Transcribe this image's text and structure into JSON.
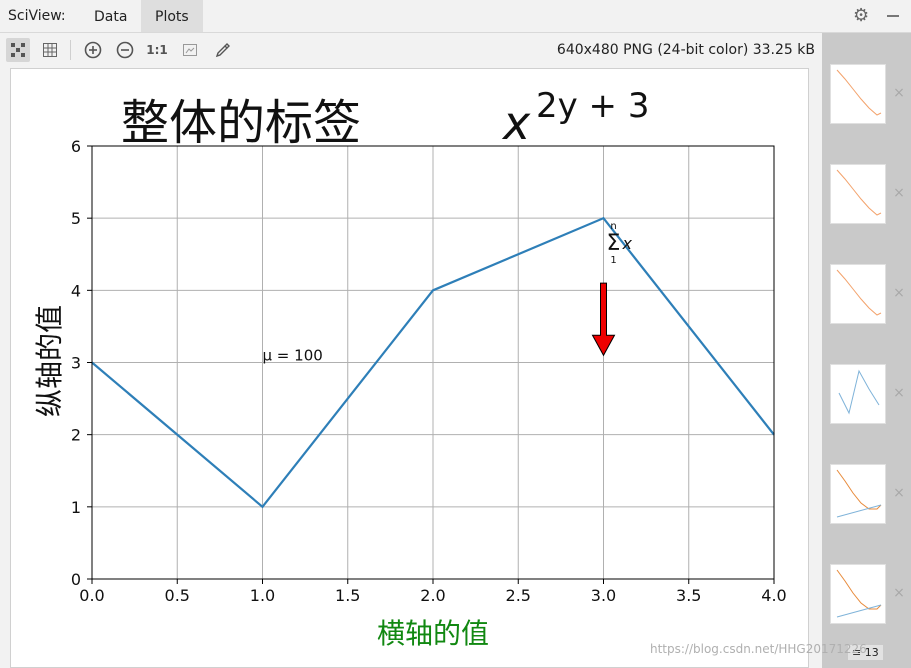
{
  "topbar": {
    "app_label": "SciView:",
    "tabs": [
      {
        "label": "Data"
      },
      {
        "label": "Plots"
      }
    ]
  },
  "toolbar": {
    "image_info": "640x480 PNG (24-bit color) 33.25 kB",
    "actual_size_label": "1:1",
    "icons": [
      "fit-icon",
      "grid-icon",
      "zoom-in-icon",
      "zoom-out-icon",
      "actual-size-icon",
      "background-icon",
      "color-picker-icon"
    ]
  },
  "thumbnails": {
    "count_label": "≡ 13",
    "close_glyph": "×"
  },
  "watermark": "https://blog.csdn.net/HHG20171226",
  "chart_data": {
    "type": "line",
    "title_cjk": "整体的标签",
    "title_math_base": "x",
    "title_math_sup": "2y + 3",
    "xlabel": "横轴的值",
    "ylabel": "纵轴的值",
    "xlabel_color": "#118811",
    "xlim": [
      0.0,
      4.0
    ],
    "ylim": [
      0,
      6
    ],
    "xticks": [
      "0.0",
      "0.5",
      "1.0",
      "1.5",
      "2.0",
      "2.5",
      "3.0",
      "3.5",
      "4.0"
    ],
    "yticks": [
      "0",
      "1",
      "2",
      "3",
      "4",
      "5",
      "6"
    ],
    "grid": true,
    "series": [
      {
        "x": [
          0,
          1,
          2,
          3,
          4
        ],
        "y": [
          3,
          1,
          4,
          5,
          2
        ],
        "color": "#2e7fb8"
      }
    ],
    "annotations": {
      "mu_text": "μ = 100",
      "mu_at": [
        1.0,
        3.0
      ],
      "sum_sup": "n",
      "sum_sym": "Σ",
      "sum_var": "x",
      "sum_sub": "1",
      "sum_at": [
        3.0,
        4.6
      ],
      "arrow_from": [
        3.0,
        4.1
      ],
      "arrow_to": [
        3.0,
        3.1
      ],
      "arrow_color": "#ee0000"
    }
  }
}
